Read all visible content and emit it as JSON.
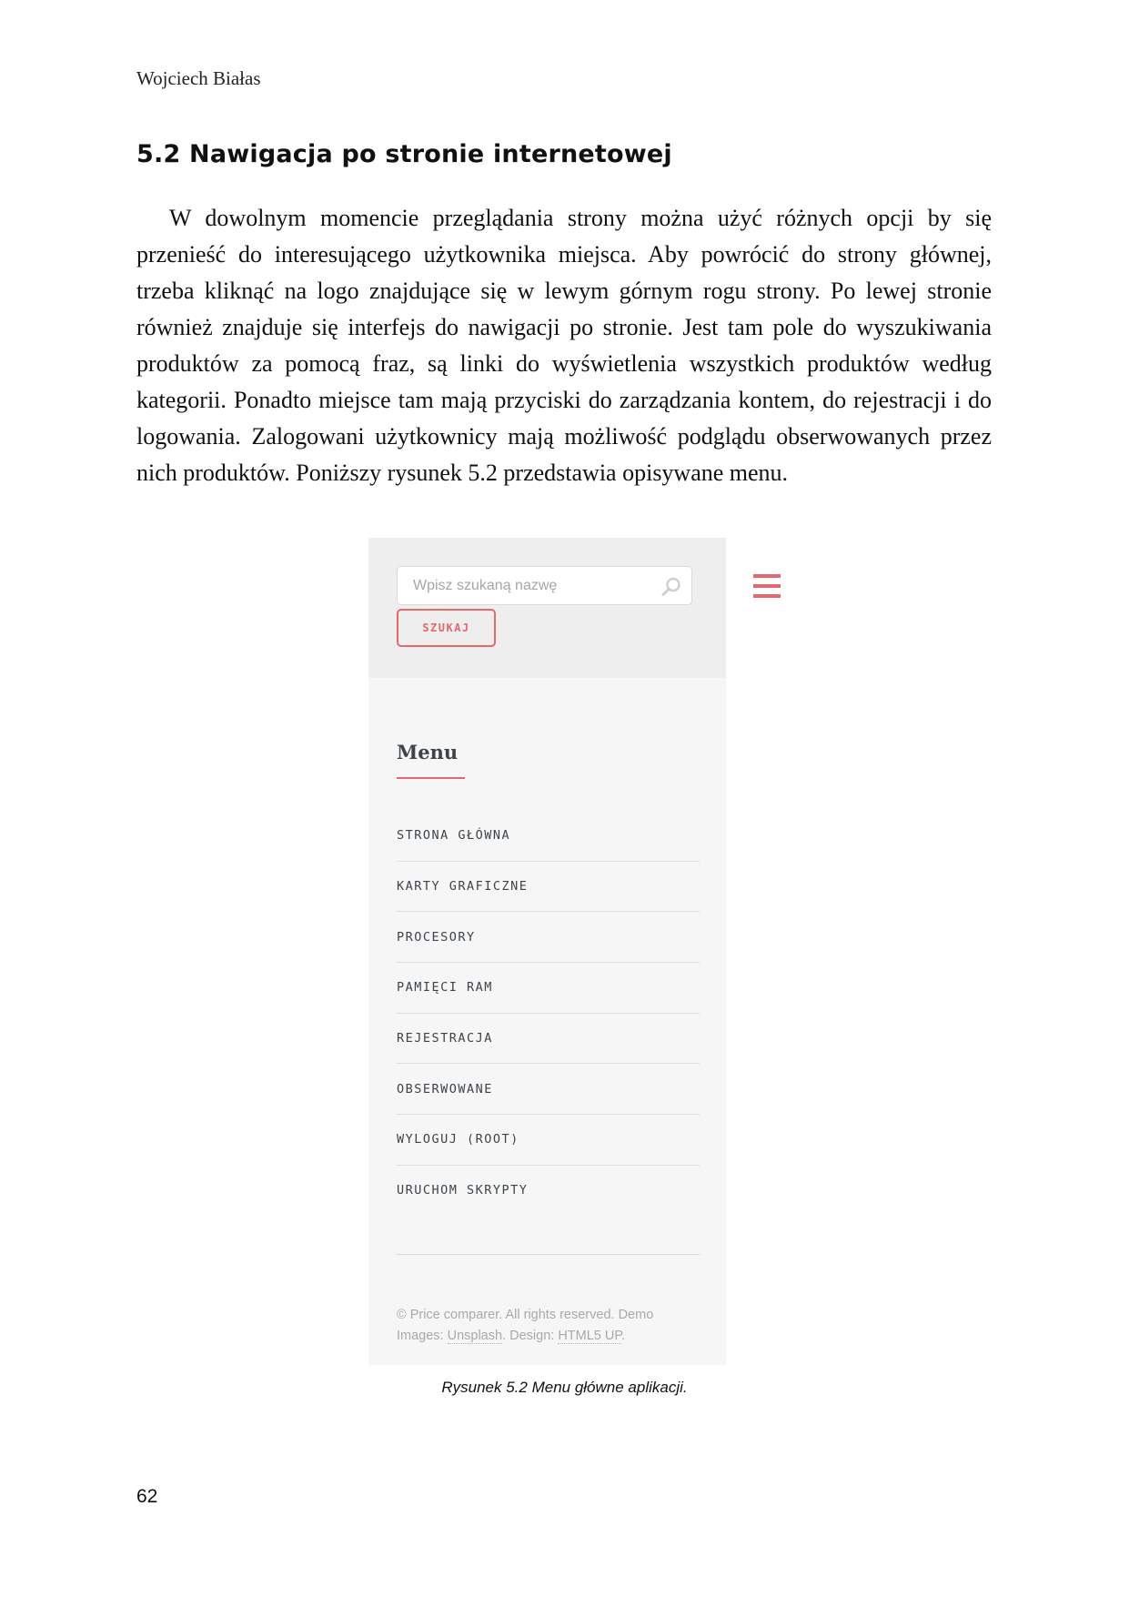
{
  "running_head": "Wojciech Białas",
  "section_title": "5.2 Nawigacja po stronie internetowej",
  "body_paragraph": "W dowolnym momencie przeglądania strony można użyć różnych opcji by się przenieść do interesującego użytkownika miejsca. Aby powrócić do strony głównej, trzeba kliknąć na logo znajdujące się w lewym górnym rogu strony. Po lewej stronie również znajduje się interfejs do nawigacji po stronie. Jest tam pole do wyszukiwania produktów za pomocą fraz, są linki do wyświetlenia wszystkich produktów według kategorii.  Ponadto miejsce tam mają przyciski do zarządzania kontem, do rejestracji i do logowania. Zalogowani użytkownicy mają możliwość podglądu obserwowanych przez nich produktów. Poniższy rysunek 5.2 przedstawia opisywane menu.",
  "figure": {
    "search": {
      "placeholder": "Wpisz szukaną nazwę",
      "button_label": "SZUKAJ",
      "icon": "search-icon"
    },
    "menu_toggle_icon": "hamburger-icon",
    "menu": {
      "heading": "Menu",
      "items": [
        "STRONA GŁÓWNA",
        "KARTY GRAFICZNE",
        "PROCESORY",
        "PAMIĘCI RAM",
        "REJESTRACJA",
        "OBSERWOWANE",
        "WYLOGUJ (ROOT)",
        "URUCHOM SKRYPTY"
      ]
    },
    "footer": {
      "text_1": "© Price comparer. All rights reserved. Demo Images: ",
      "link_1": "Unsplash",
      "text_2": ". Design: ",
      "link_2": "HTML5 UP",
      "text_3": "."
    }
  },
  "caption": "Rysunek 5.2 Menu główne aplikacji.",
  "page_number": "62",
  "colors": {
    "accent": "#e5686f",
    "sidebar_bg": "#f6f6f7",
    "search_zone_bg": "#eeeeef",
    "menu_text": "#3d4449"
  }
}
